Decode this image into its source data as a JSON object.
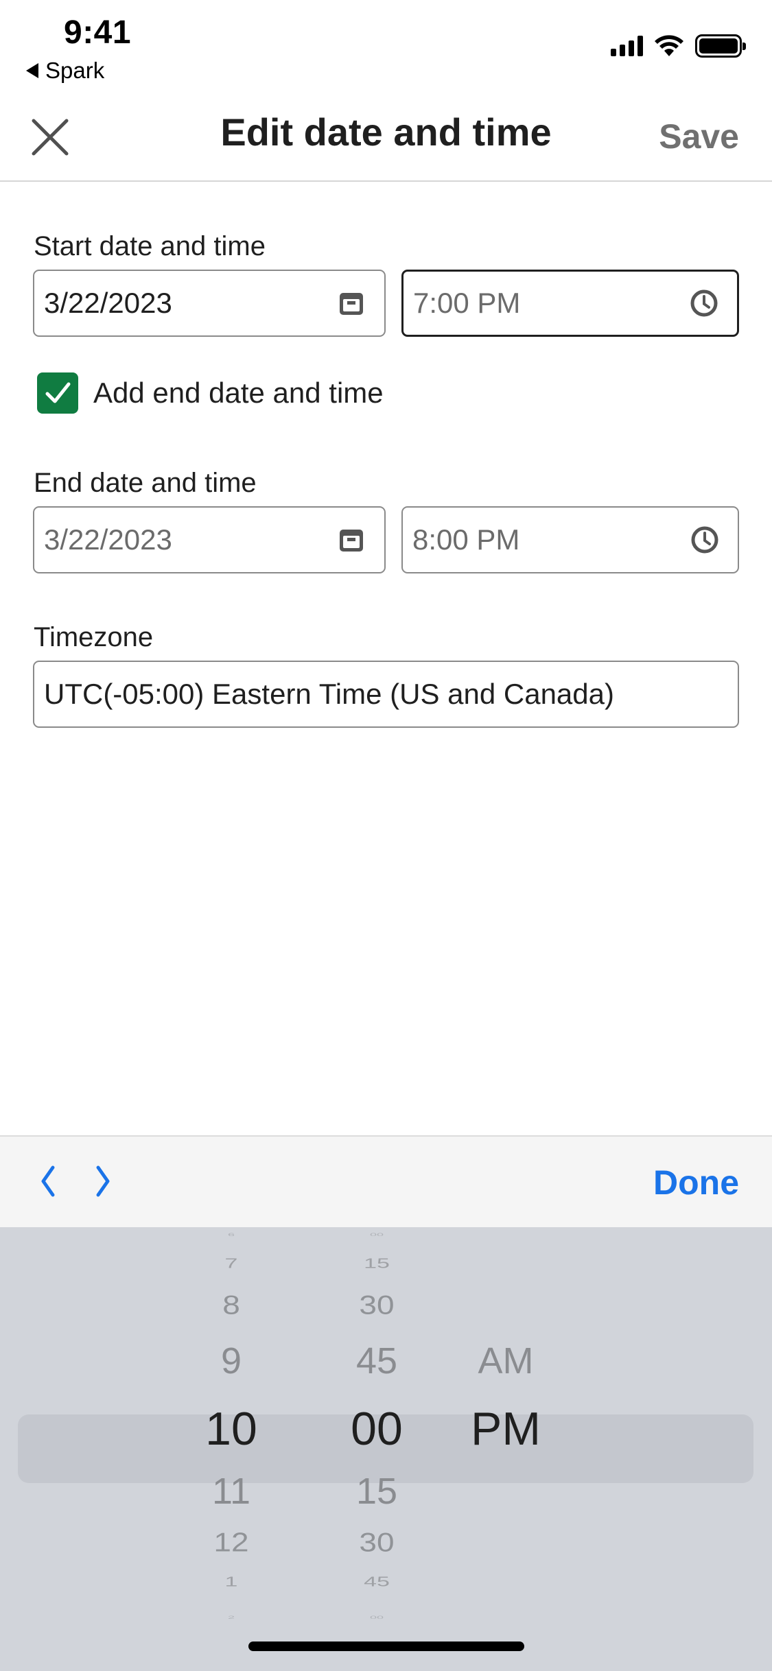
{
  "status_bar": {
    "time": "9:41",
    "back_app": "Spark",
    "icons": [
      "signal-icon",
      "wifi-icon",
      "battery-icon"
    ]
  },
  "header": {
    "close_icon": "close-icon",
    "title": "Edit date and time",
    "save_label": "Save"
  },
  "start": {
    "label": "Start date and time",
    "date_value": "3/22/2023",
    "time_placeholder": "7:00 PM",
    "date_icon": "calendar-icon",
    "time_icon": "clock-icon"
  },
  "end_toggle": {
    "label": "Add end date and time",
    "checked": true
  },
  "end": {
    "label": "End date and time",
    "date_value": "3/22/2023",
    "time_value": "8:00 PM"
  },
  "timezone": {
    "label": "Timezone",
    "value": "UTC(-05:00) Eastern Time (US and Canada)"
  },
  "accessory": {
    "prev_icon": "chevron-left-icon",
    "next_icon": "chevron-right-icon",
    "done_label": "Done"
  },
  "picker": {
    "hours": [
      "6",
      "7",
      "8",
      "9",
      "10",
      "11",
      "12",
      "1",
      "2"
    ],
    "minutes": [
      "00",
      "15",
      "30",
      "45",
      "00",
      "15",
      "30",
      "45",
      "00"
    ],
    "periods": [
      "AM",
      "PM"
    ],
    "selected": {
      "hour": "10",
      "minute": "00",
      "period": "PM"
    }
  },
  "colors": {
    "accent": "#1a73e8",
    "checkbox": "#107c41",
    "picker_bg": "#d1d4da"
  }
}
